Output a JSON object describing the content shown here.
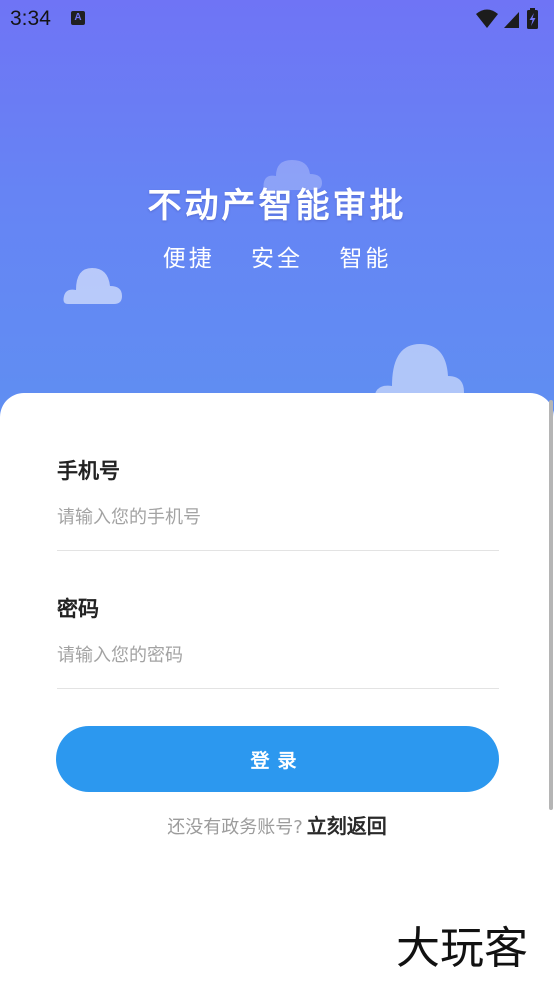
{
  "status_bar": {
    "time": "3:34",
    "notification_letter": "A"
  },
  "hero": {
    "title": "不动产智能审批",
    "tags": [
      "便捷",
      "安全",
      "智能"
    ]
  },
  "form": {
    "phone": {
      "label": "手机号",
      "placeholder": "请输入您的手机号",
      "value": ""
    },
    "password": {
      "label": "密码",
      "placeholder": "请输入您的密码",
      "value": ""
    },
    "login_button": "登录",
    "register_prompt": "还没有政务账号?",
    "register_link": "立刻返回"
  },
  "watermark": "大玩客",
  "colors": {
    "hero_top": "#6f74f5",
    "hero_bottom": "#5f8ff2",
    "button": "#2c98ef"
  }
}
